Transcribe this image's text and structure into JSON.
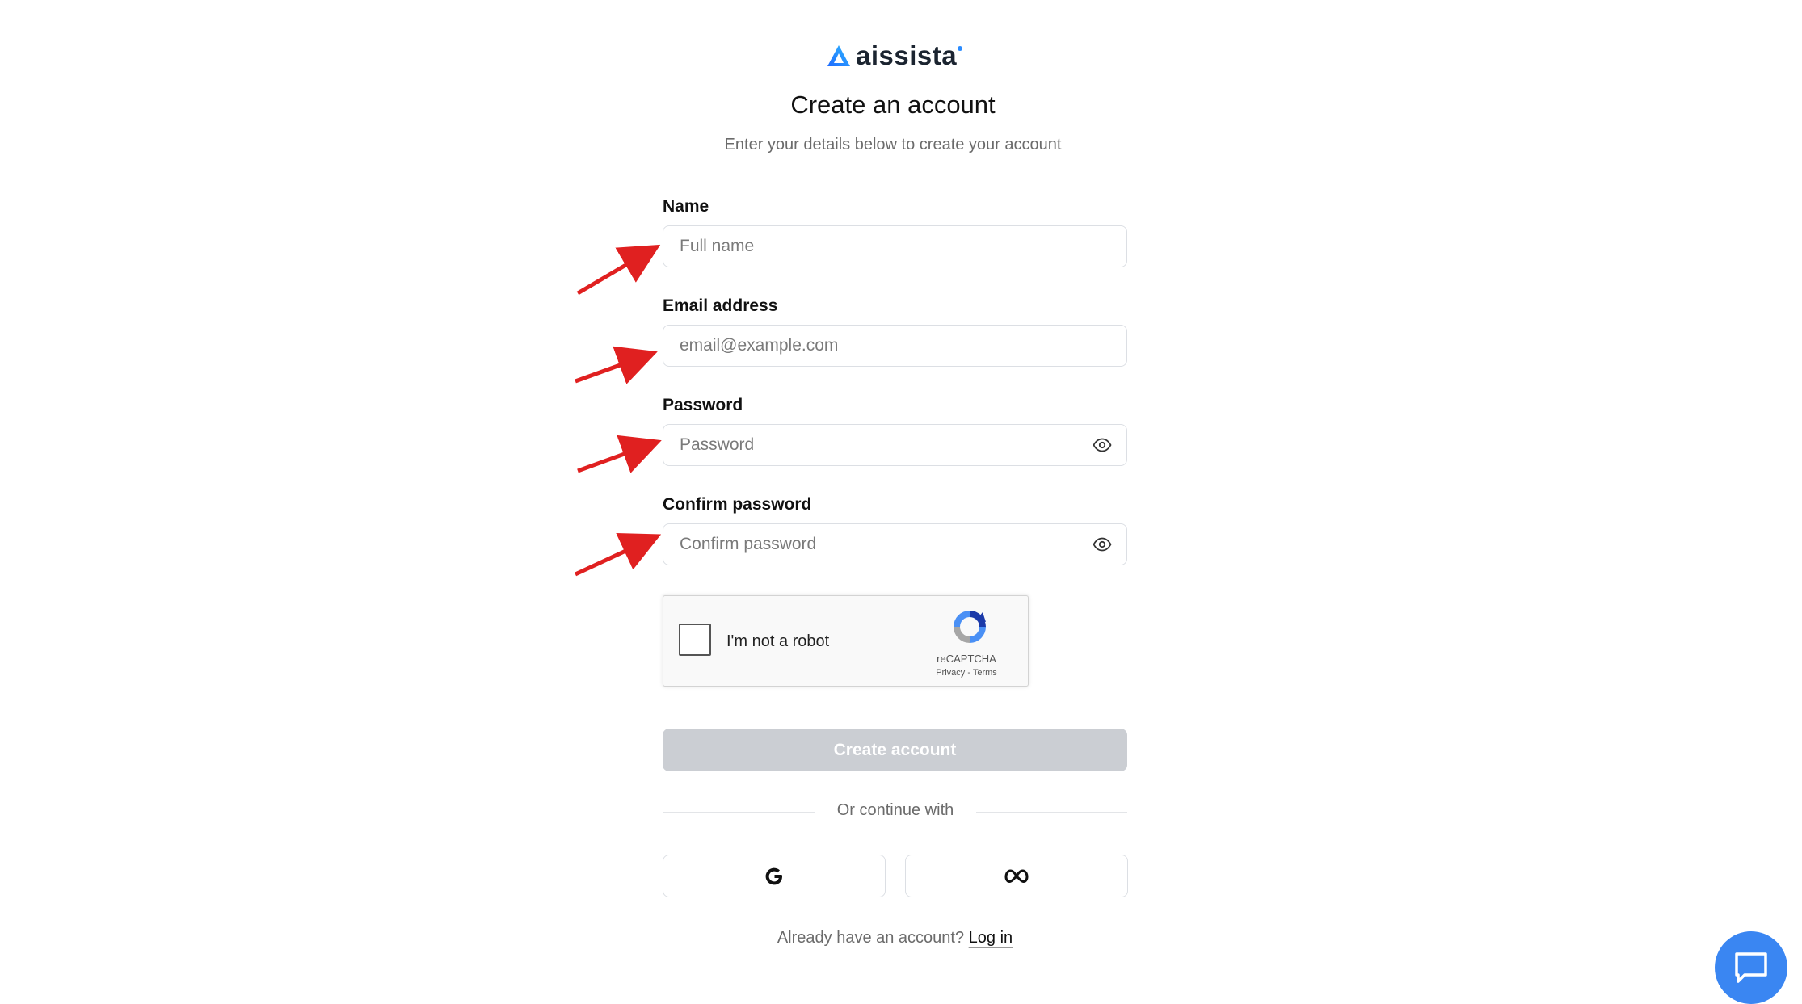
{
  "brand": {
    "name": "aissista"
  },
  "header": {
    "title": "Create an account",
    "subtitle": "Enter your details below to create your account"
  },
  "form": {
    "name": {
      "label": "Name",
      "placeholder": "Full name",
      "value": ""
    },
    "email": {
      "label": "Email address",
      "placeholder": "email@example.com",
      "value": ""
    },
    "password": {
      "label": "Password",
      "placeholder": "Password",
      "value": ""
    },
    "confirm_password": {
      "label": "Confirm password",
      "placeholder": "Confirm password",
      "value": ""
    }
  },
  "captcha": {
    "label": "I'm not a robot",
    "brand": "reCAPTCHA",
    "privacy": "Privacy",
    "separator": " - ",
    "terms": "Terms"
  },
  "actions": {
    "create_label": "Create account",
    "divider_text": "Or continue with"
  },
  "footer": {
    "prompt": "Already have an account? ",
    "login_label": "Log in"
  },
  "colors": {
    "brand_blue": "#1e7bff",
    "button_disabled": "#cbced3",
    "chat_bubble": "#3a86f2",
    "annotation_arrow": "#e02020"
  },
  "icons": {
    "password_toggle": "eye-icon",
    "google": "google-icon",
    "meta": "meta-icon",
    "chat": "chat-bubble-icon"
  }
}
